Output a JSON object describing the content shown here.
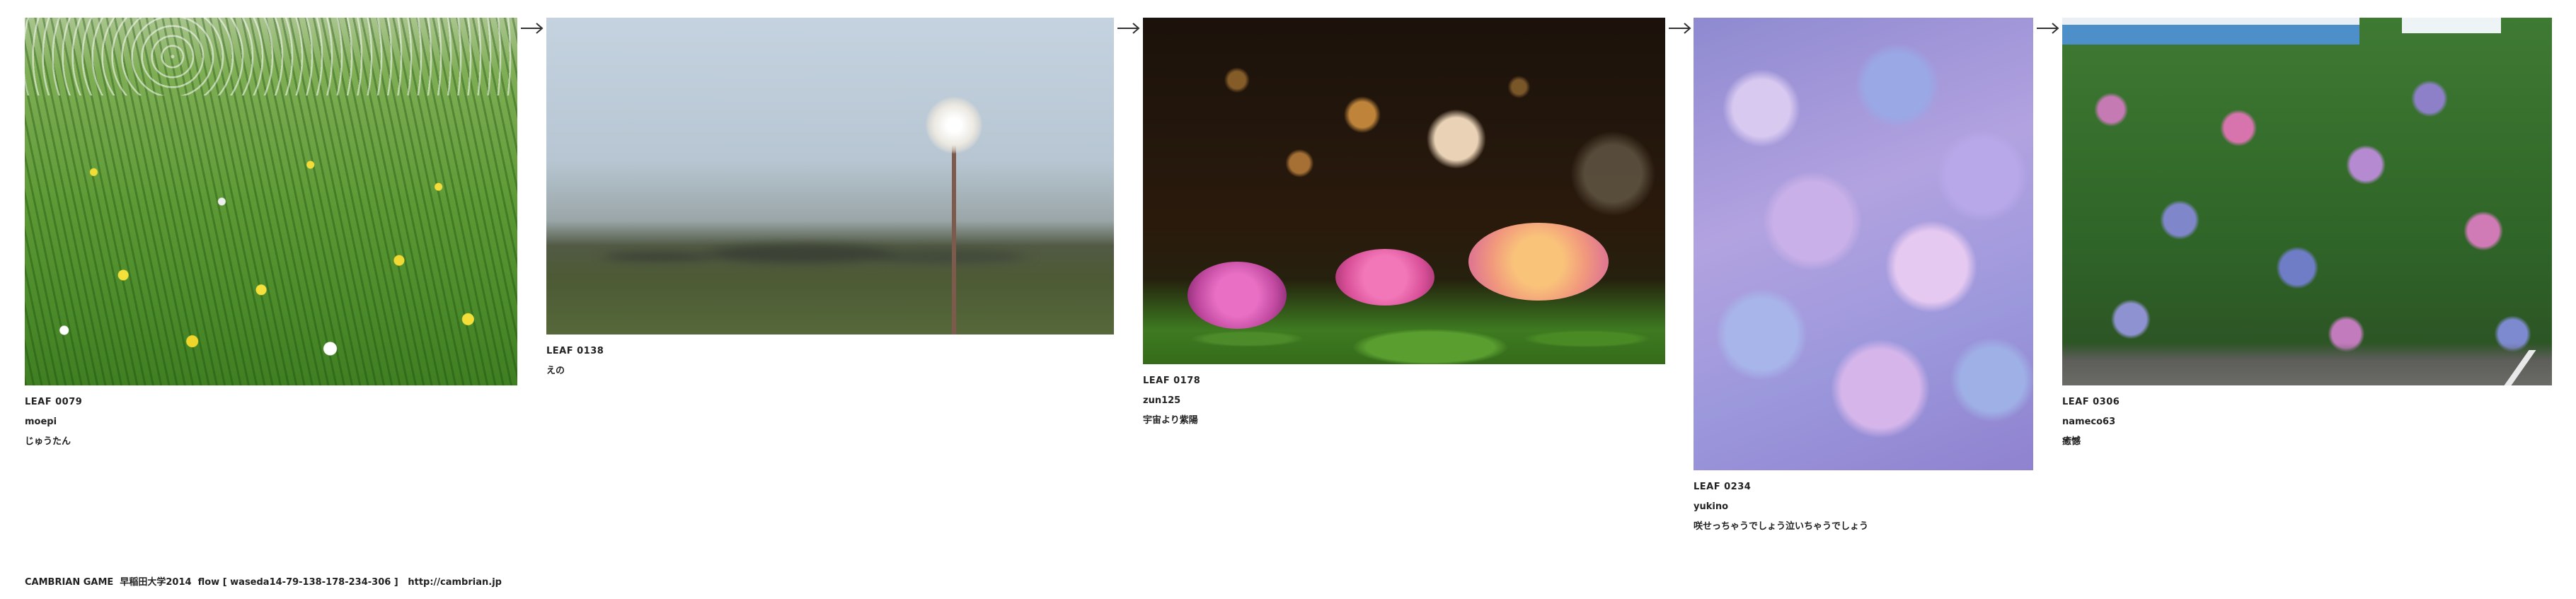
{
  "leaves": [
    {
      "id": "LEAF 0079",
      "user": "moepi",
      "title": "じゅうたん",
      "image": "dandelion meadow photo"
    },
    {
      "id": "LEAF 0138",
      "user": "えの",
      "title": "",
      "image": "lone dandelion photo"
    },
    {
      "id": "LEAF 0178",
      "user": "zun125",
      "title": "宇宙より紫陽",
      "image": "hydrangea bokeh photo"
    },
    {
      "id": "LEAF 0234",
      "user": "yukino",
      "title": "咲せっちゃうでしょう泣いちゃうでしょう",
      "image": "hydrangea close-up photo"
    },
    {
      "id": "LEAF 0306",
      "user": "nameco63",
      "title": "癒憾",
      "image": "hydrangea bushes photo"
    }
  ],
  "arrow_icon": "arrow-right-icon",
  "footer": {
    "text": "CAMBRIAN GAME  早稲田大学2014  flow [ waseda14-79-138-178-234-306 ]   ",
    "link": "http://cambrian.jp"
  }
}
